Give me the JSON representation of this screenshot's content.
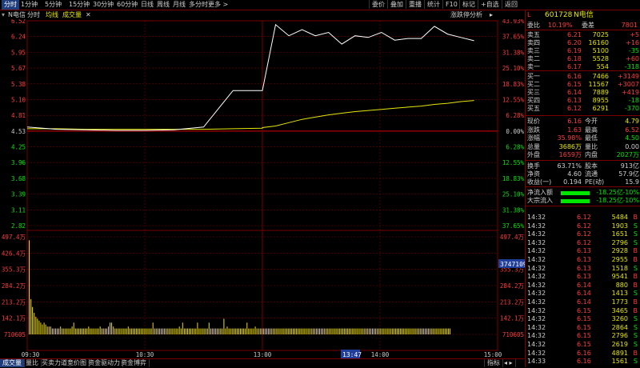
{
  "topbar": {
    "items": [
      "分时",
      "1分钟",
      "5分钟",
      "15分钟",
      "30分钟",
      "60分钟",
      "日线",
      "周线",
      "月线",
      "多分时",
      "更多 >"
    ],
    "right": [
      "委价",
      "叠加",
      "重播",
      "统计",
      "F10",
      "标记",
      "+自选",
      "返回"
    ]
  },
  "subbar": {
    "name": "N电信",
    "tab1": "分时",
    "tab2": "均线",
    "tab3": "成交量",
    "right": "涨跌停分析"
  },
  "price_axis": {
    "left": [
      "6.52",
      "6.24",
      "5.95",
      "5.67",
      "5.38",
      "5.10",
      "4.81",
      "4.53",
      "4.25",
      "3.96",
      "3.68",
      "3.39",
      "3.11",
      "2.82"
    ],
    "right": [
      "43.93%",
      "37.65%",
      "31.38%",
      "25.10%",
      "18.83%",
      "12.55%",
      "6.28%",
      "0.00%",
      "6.28%",
      "12.55%",
      "18.83%",
      "25.10%",
      "31.38%",
      "37.65%"
    ]
  },
  "volume_axis": {
    "left": [
      "497.4万",
      "426.4万",
      "355.3万",
      "284.2万",
      "213.2万",
      "142.1万",
      "710605"
    ],
    "right": [
      "497.4万",
      "",
      "355.3万",
      "284.2万",
      "213.2万",
      "142.1万",
      "710605"
    ],
    "cursor_value": "3747109"
  },
  "time_labels": [
    "09:30",
    "10:30",
    "13:00",
    "14:00",
    "15:00"
  ],
  "time_cursor": "13:47",
  "chart_data": {
    "type": "line",
    "x": [
      "09:30",
      "09:45",
      "10:00",
      "10:15",
      "10:30",
      "10:45",
      "11:00",
      "11:15",
      "11:30",
      "13:00",
      "13:02",
      "13:05",
      "13:10",
      "13:15",
      "13:20",
      "13:25",
      "13:30",
      "13:35",
      "13:40",
      "13:45",
      "13:50",
      "14:00",
      "14:15",
      "14:30",
      "14:45",
      "15:00"
    ],
    "series": [
      {
        "values": [
          4.6,
          4.56,
          4.55,
          4.54,
          4.54,
          4.55,
          4.6,
          5.26,
          5.26,
          5.26,
          6.45,
          6.25,
          6.36,
          6.25,
          6.31,
          6.1,
          6.25,
          6.22,
          6.31,
          6.17,
          6.2,
          6.2,
          6.42,
          6.28,
          6.22,
          6.16
        ]
      },
      {
        "values": [
          4.57,
          4.57,
          4.56,
          4.56,
          4.56,
          4.56,
          4.56,
          4.57,
          4.58,
          4.59,
          4.62,
          4.68,
          4.74,
          4.78,
          4.82,
          4.85,
          4.88,
          4.9,
          4.92,
          4.94,
          4.96,
          4.98,
          5.01,
          5.03,
          5.06,
          5.08
        ]
      }
    ],
    "ylim": [
      2.82,
      6.52
    ],
    "volume": [
      480,
      180,
      140,
      110,
      90,
      80,
      70,
      60,
      50,
      60,
      50,
      40,
      40,
      40,
      30,
      30,
      30,
      30,
      30,
      40,
      30,
      30,
      30,
      30,
      30,
      30,
      40,
      60,
      30,
      30,
      30,
      30,
      30,
      30,
      30,
      30,
      40,
      30,
      30,
      30,
      30,
      30,
      30,
      40,
      30,
      30,
      30,
      30,
      40,
      60,
      60,
      40,
      30,
      30,
      30,
      30,
      30,
      30,
      30,
      30,
      40,
      30,
      30,
      30,
      30,
      30,
      30,
      30,
      30,
      30,
      30,
      30,
      30,
      30,
      30,
      60,
      30,
      30,
      30,
      30,
      30,
      30,
      30,
      30,
      30,
      30,
      30,
      30,
      30,
      30,
      30,
      40,
      30,
      60,
      30,
      30,
      30,
      30,
      30,
      30,
      30,
      30,
      60,
      30,
      30,
      30,
      30,
      30,
      30,
      60,
      30,
      30,
      30,
      30,
      30,
      30,
      30,
      30,
      80,
      30,
      40,
      30,
      30,
      30,
      30,
      30,
      30,
      30,
      30,
      30,
      30,
      30,
      60,
      30,
      30,
      30,
      30,
      40,
      30,
      30,
      30,
      30,
      30,
      30,
      30,
      30,
      30,
      30,
      30,
      30,
      30,
      30,
      30,
      30,
      30,
      30,
      30,
      30,
      30,
      30,
      30,
      30,
      30,
      30,
      30,
      30,
      30,
      30,
      30,
      30,
      30,
      30,
      30,
      30,
      30,
      30,
      30,
      30,
      30,
      30,
      30,
      30,
      30,
      30,
      30,
      30,
      30,
      30,
      30,
      30,
      30,
      30,
      30,
      30,
      30,
      30,
      30,
      30,
      30,
      30,
      30,
      30,
      30,
      30,
      30,
      30,
      30,
      30,
      30,
      30,
      30,
      30,
      30,
      30,
      30,
      30,
      30,
      30,
      30,
      30,
      30,
      30,
      30,
      30,
      30,
      30,
      30,
      30,
      30,
      30,
      30,
      30,
      30,
      30,
      30,
      30,
      30,
      30,
      30,
      30,
      30,
      30,
      30,
      30,
      30,
      30,
      30,
      30,
      30,
      30,
      30,
      30,
      30,
      30,
      30,
      30
    ],
    "volume_ylim": [
      0,
      497.4
    ]
  },
  "quote": {
    "code": "601728",
    "name": "N电信",
    "weibi_label": "委比",
    "weibi": "10.19%",
    "weicha_label": "委差",
    "weicha": "7801",
    "sells": [
      {
        "label": "卖五",
        "price": "6.21",
        "vol": "7025",
        "chg": "+5"
      },
      {
        "label": "卖四",
        "price": "6.20",
        "vol": "16160",
        "chg": "+16"
      },
      {
        "label": "卖三",
        "price": "6.19",
        "vol": "5100",
        "chg": "-35"
      },
      {
        "label": "卖二",
        "price": "6.18",
        "vol": "5528",
        "chg": "+60"
      },
      {
        "label": "卖一",
        "price": "6.17",
        "vol": "554",
        "chg": "-318"
      }
    ],
    "buys": [
      {
        "label": "买一",
        "price": "6.16",
        "vol": "7466",
        "chg": "+3149"
      },
      {
        "label": "买二",
        "price": "6.15",
        "vol": "11567",
        "chg": "+3007"
      },
      {
        "label": "买三",
        "price": "6.14",
        "vol": "7889",
        "chg": "+419"
      },
      {
        "label": "买四",
        "price": "6.13",
        "vol": "8955",
        "chg": "-18"
      },
      {
        "label": "买五",
        "price": "6.12",
        "vol": "6291",
        "chg": "-370"
      }
    ],
    "stats": [
      {
        "l1": "现价",
        "v1": "6.16",
        "l2": "今开",
        "v2": "4.79"
      },
      {
        "l1": "涨跌",
        "v1": "1.63",
        "l2": "最高",
        "v2": "6.52"
      },
      {
        "l1": "涨幅",
        "v1": "35.98%",
        "l2": "最低",
        "v2": "4.50"
      },
      {
        "l1": "总量",
        "v1": "3686万",
        "l2": "量比",
        "v2": "0.00"
      },
      {
        "l1": "外盘",
        "v1": "1659万",
        "l2": "内盘",
        "v2": "2027万"
      }
    ],
    "stats2": [
      {
        "l1": "换手",
        "v1": "63.71%",
        "l2": "股本",
        "v2": "913亿"
      },
      {
        "l1": "净资",
        "v1": "4.60",
        "l2": "流通",
        "v2": "57.9亿"
      },
      {
        "l1": "收益(一)",
        "v1": "0.194",
        "l2": "PE(动)",
        "v2": "15.9"
      }
    ],
    "flows": [
      {
        "label": "净流入额",
        "value": "-18.25亿",
        "pct": "-10%"
      },
      {
        "label": "大宗流入",
        "value": "-18.25亿",
        "pct": "-10%"
      }
    ],
    "ticks": [
      {
        "t": "14:32",
        "p": "6.12",
        "v": "5484",
        "d": "B"
      },
      {
        "t": "14:32",
        "p": "6.12",
        "v": "1903",
        "d": "S"
      },
      {
        "t": "14:32",
        "p": "6.12",
        "v": "1651",
        "d": "S"
      },
      {
        "t": "14:32",
        "p": "6.12",
        "v": "2796",
        "d": "S"
      },
      {
        "t": "14:32",
        "p": "6.13",
        "v": "2928",
        "d": "B"
      },
      {
        "t": "14:32",
        "p": "6.13",
        "v": "2955",
        "d": "B"
      },
      {
        "t": "14:32",
        "p": "6.13",
        "v": "1518",
        "d": "S"
      },
      {
        "t": "14:32",
        "p": "6.13",
        "v": "9541",
        "d": "B"
      },
      {
        "t": "14:32",
        "p": "6.14",
        "v": "880",
        "d": "B"
      },
      {
        "t": "14:32",
        "p": "6.14",
        "v": "1413",
        "d": "S"
      },
      {
        "t": "14:32",
        "p": "6.14",
        "v": "1773",
        "d": "B"
      },
      {
        "t": "14:32",
        "p": "6.15",
        "v": "3465",
        "d": "B"
      },
      {
        "t": "14:32",
        "p": "6.15",
        "v": "3260",
        "d": "S"
      },
      {
        "t": "14:32",
        "p": "6.15",
        "v": "2864",
        "d": "S"
      },
      {
        "t": "14:32",
        "p": "6.15",
        "v": "2796",
        "d": "S"
      },
      {
        "t": "14:32",
        "p": "6.15",
        "v": "2619",
        "d": "S"
      },
      {
        "t": "14:32",
        "p": "6.16",
        "v": "4891",
        "d": "B"
      },
      {
        "t": "14:33",
        "p": "6.16",
        "v": "1561",
        "d": "S"
      }
    ]
  },
  "bottombar": {
    "items": [
      "成交量",
      "量比",
      "买卖力道",
      "竞价图",
      "资金驱动力",
      "资金博弈"
    ],
    "right": "指标"
  },
  "colors": {
    "up": "#ff3b3b",
    "down": "#00e600",
    "price_line": "#ffffff",
    "avg_line": "#e6e600",
    "grid": "#7a0000",
    "axis_text": "#ff3b3b"
  }
}
